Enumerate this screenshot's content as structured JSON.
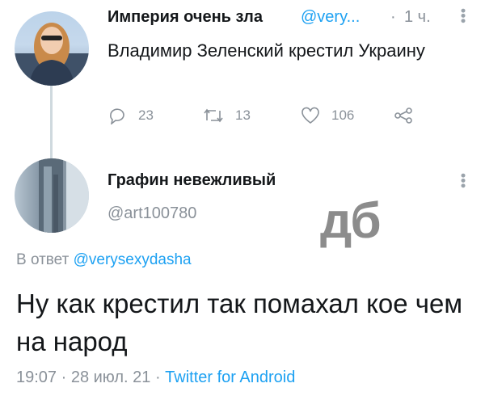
{
  "tweet1": {
    "author_name": "Империя очень зла",
    "handle": "@very...",
    "separator": "·",
    "time": "1 ч.",
    "text": "Владимир Зеленский крестил Украину",
    "stats": {
      "replies": "23",
      "retweets": "13",
      "likes": "106"
    }
  },
  "tweet2": {
    "author_name": "Графин невежливый",
    "handle": "@art100780",
    "reply_prefix": "В ответ",
    "reply_handle": "@verysexydasha",
    "text": "Ну как крестил так помахал кое чем на народ",
    "timestamp": "19:07 · 28 июл. 21 ·",
    "client": "Twitter for Android"
  },
  "watermark": "дб",
  "colors": {
    "link": "#1da1f2",
    "muted": "#8a9199",
    "text": "#14171a"
  },
  "icons": [
    "reply-icon",
    "retweet-icon",
    "like-icon",
    "share-icon",
    "more-icon"
  ]
}
